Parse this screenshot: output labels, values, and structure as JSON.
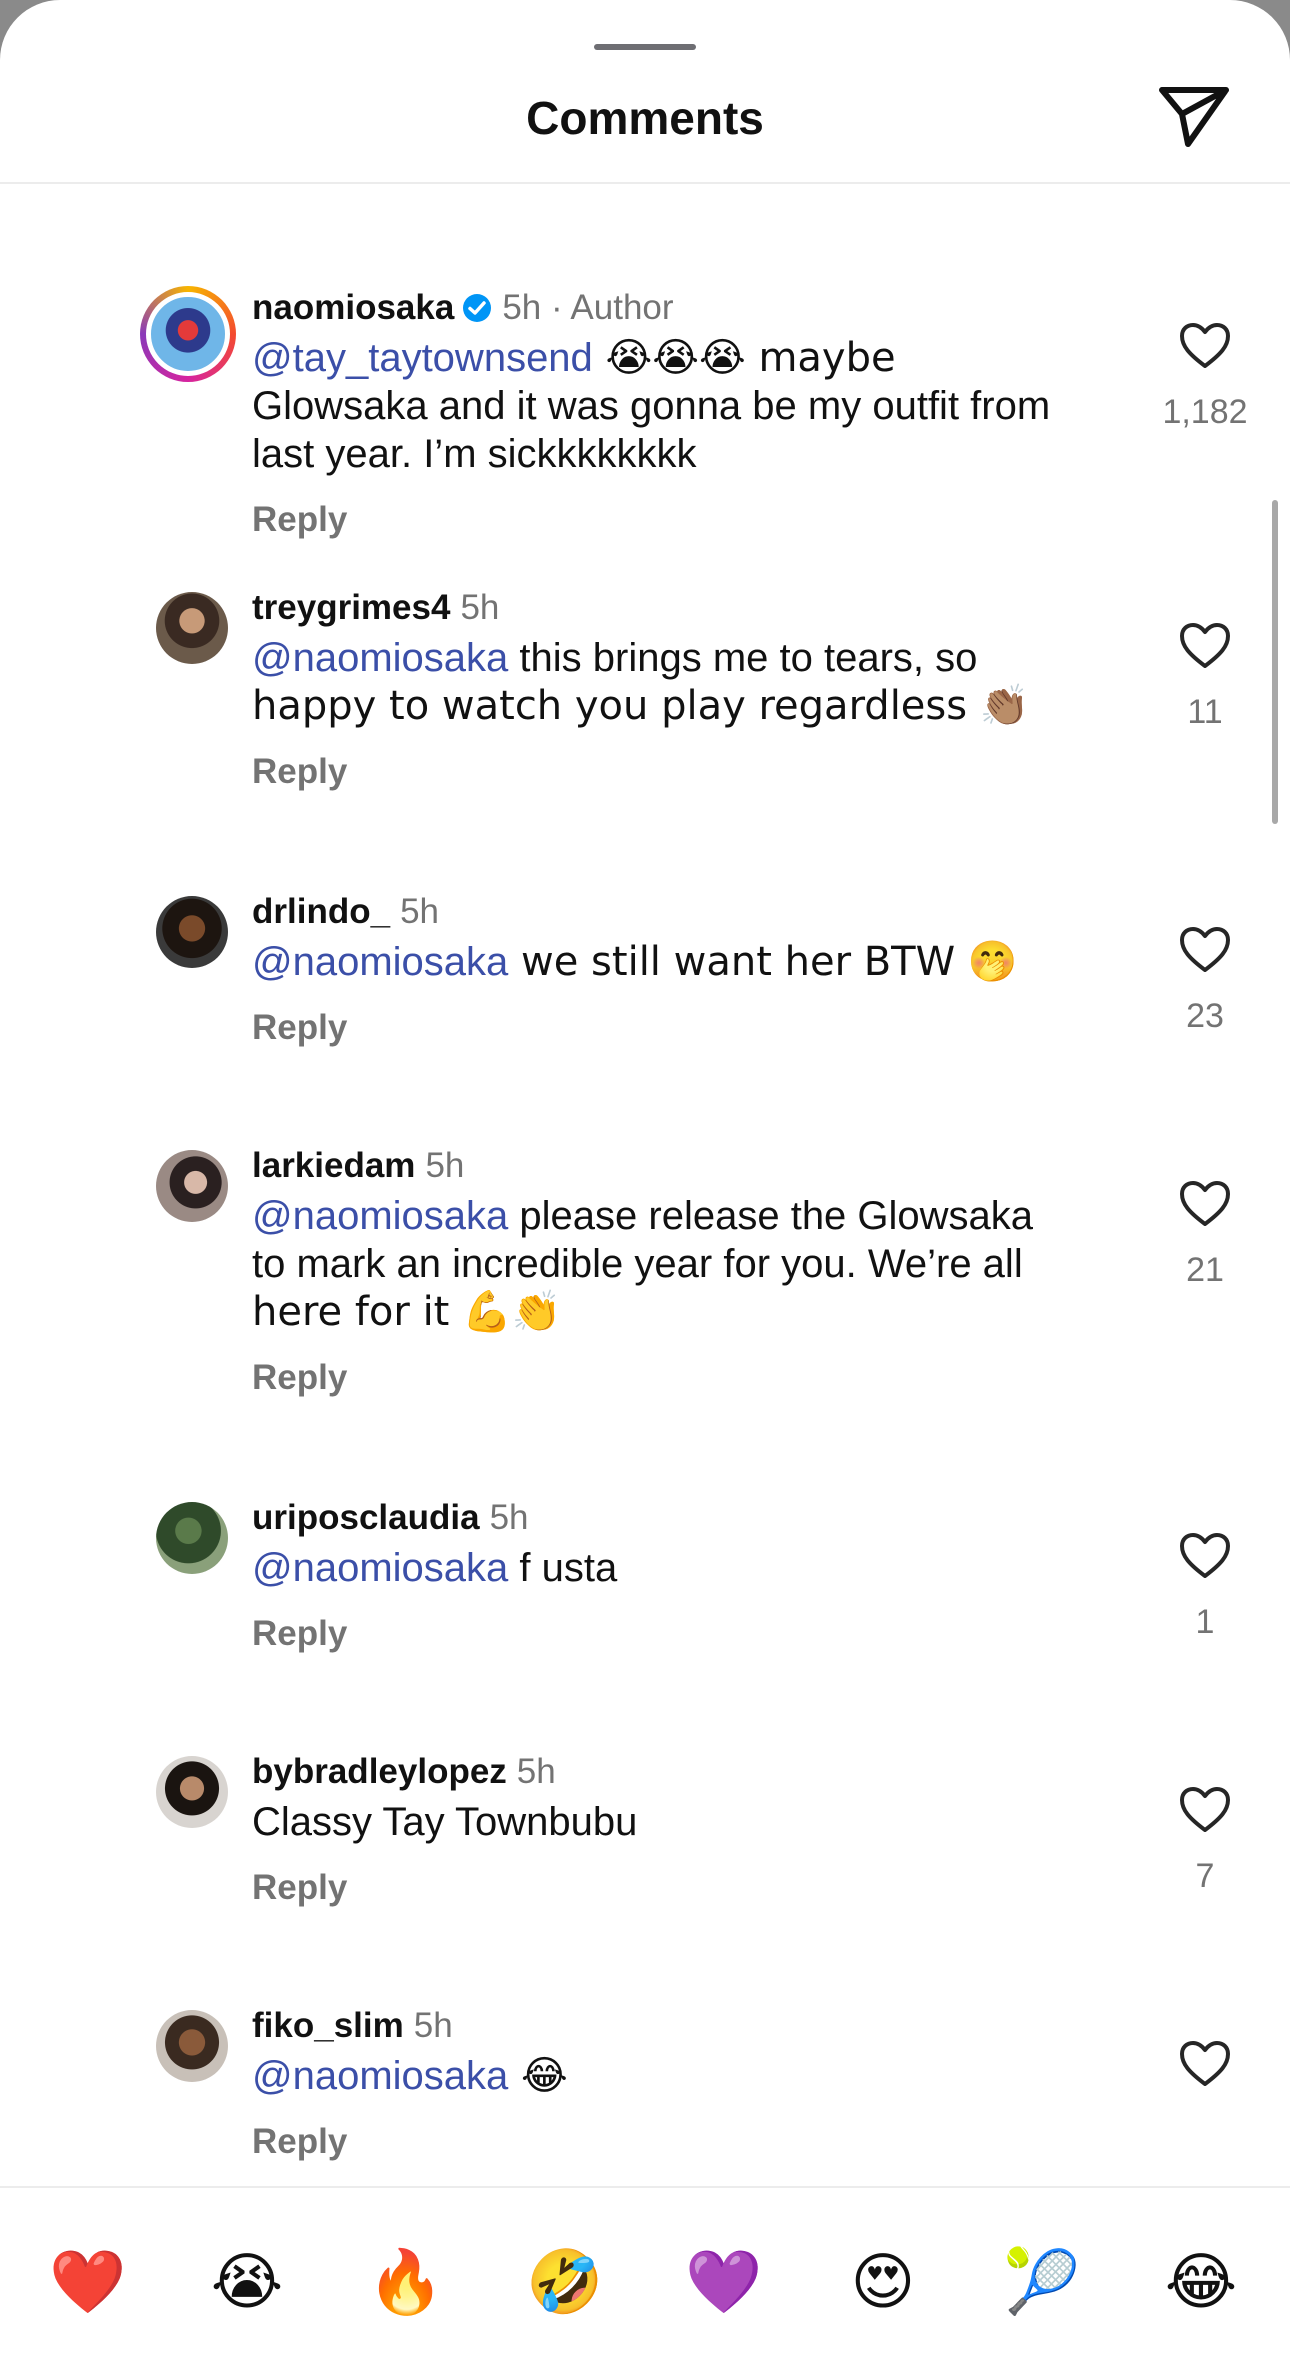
{
  "header": {
    "title": "Comments",
    "share_icon": "paper-plane-icon"
  },
  "comments": [
    {
      "username": "naomiosaka",
      "verified": true,
      "time": "5h · Author",
      "mention": "@tay_taytownsend",
      "text_after_mention": " 😭😭😭 maybe",
      "text_line2": "Glowsaka and it was gonna be my outfit from",
      "text_line3": "last year. I’m sickkkkkkkk",
      "reply": "Reply",
      "likes": "1,182"
    },
    {
      "username": "treygrimes4",
      "time": "5h",
      "mention": "@naomiosaka",
      "text_after_mention": " this brings me to tears, so",
      "text_line2": "happy to watch you play regardless 👏🏽",
      "reply": "Reply",
      "likes": "11"
    },
    {
      "username": "drlindo_",
      "time": "5h",
      "mention": "@naomiosaka",
      "text_after_mention": " we still want her BTW 🤭",
      "reply": "Reply",
      "likes": "23"
    },
    {
      "username": "larkiedam",
      "time": "5h",
      "mention": "@naomiosaka",
      "text_after_mention": " please release the Glowsaka",
      "text_line2": "to mark an incredible year for you. We’re all",
      "text_line3": "here for it 💪👏",
      "reply": "Reply",
      "likes": "21"
    },
    {
      "username": "uriposclaudia",
      "time": "5h",
      "mention": "@naomiosaka",
      "text_after_mention": " f usta",
      "reply": "Reply",
      "likes": "1"
    },
    {
      "username": "bybradleylopez",
      "time": "5h",
      "text": "Classy Tay Townbubu",
      "reply": "Reply",
      "likes": "7"
    },
    {
      "username": "fiko_slim",
      "time": "5h",
      "mention": "@naomiosaka",
      "text_after_mention": " 😂",
      "reply": "Reply"
    }
  ],
  "reactions": [
    "❤️",
    "😭",
    "🔥",
    "🤣",
    "💜",
    "😍",
    "🎾",
    "😂"
  ],
  "colors": {
    "mention": "#3b4fa8",
    "secondary_text": "#737373",
    "verified": "#0095f6"
  }
}
